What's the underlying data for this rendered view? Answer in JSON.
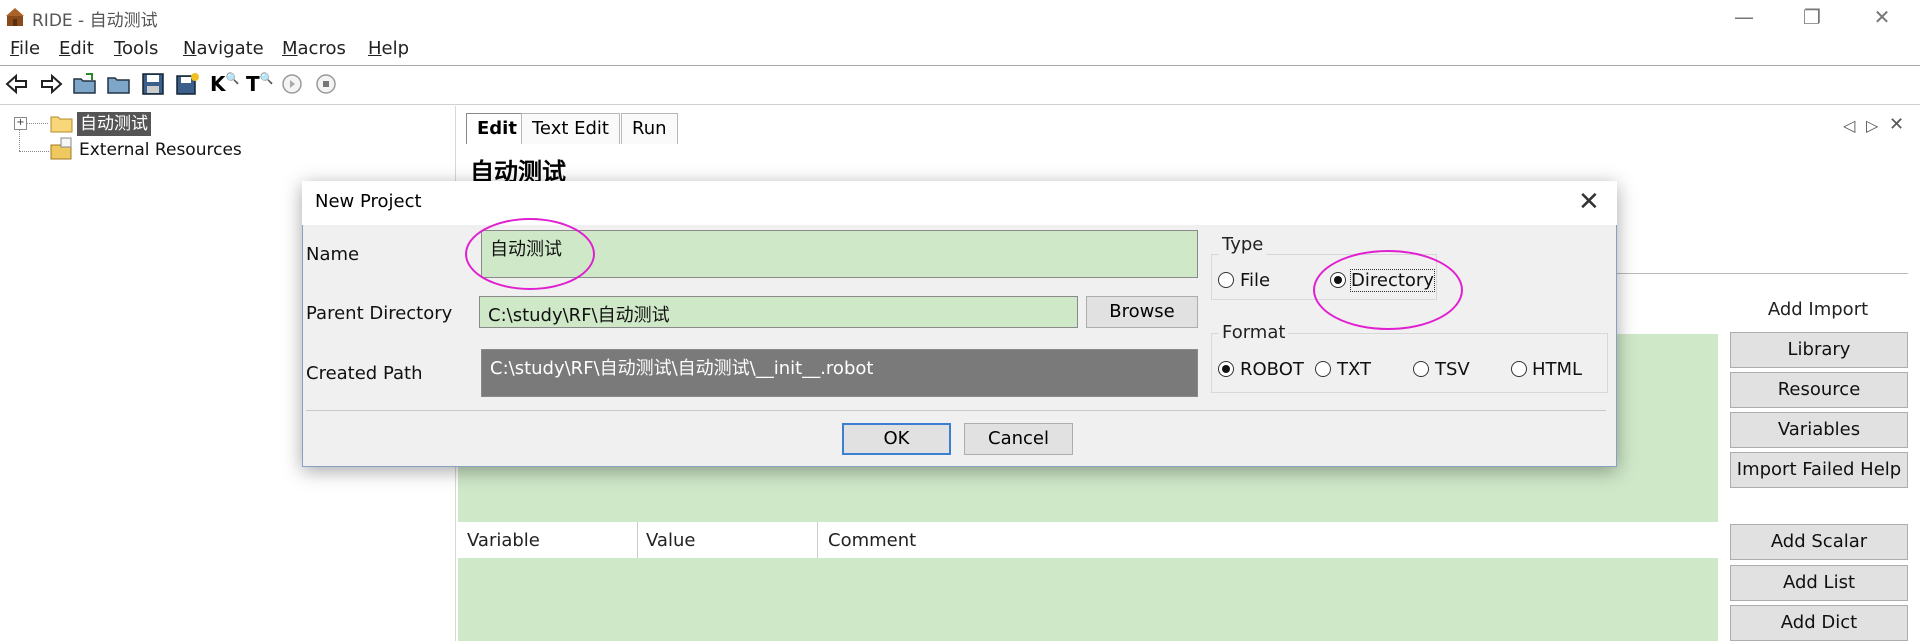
{
  "window": {
    "title": "RIDE - 自动测试",
    "controls": [
      "minimize",
      "restore",
      "close"
    ]
  },
  "menu": [
    {
      "label": "File",
      "key": "F",
      "rest": "ile"
    },
    {
      "label": "Edit",
      "key": "E",
      "rest": "dit"
    },
    {
      "label": "Tools",
      "key": "T",
      "rest": "ools"
    },
    {
      "label": "Navigate",
      "key": "N",
      "rest": "avigate"
    },
    {
      "label": "Macros",
      "key": "M",
      "rest": "acros"
    },
    {
      "label": "Help",
      "key": "H",
      "rest": "elp"
    }
  ],
  "toolbar": {
    "icons": [
      "back-icon",
      "forward-icon",
      "open-project-icon",
      "open-directory-icon",
      "save-icon",
      "save-all-icon",
      "search-keywords-icon",
      "search-tests-icon",
      "run-icon",
      "stop-icon"
    ],
    "k_label": "K",
    "t_label": "T"
  },
  "tree": {
    "root_label": "自动测试",
    "external_label": "External Resources"
  },
  "editor": {
    "tabs": [
      "Edit",
      "Text Edit",
      "Run"
    ],
    "active_tab": "Edit",
    "suite_title": "自动测试",
    "variables_columns": [
      "Variable",
      "Value",
      "Comment"
    ],
    "side": {
      "add_import_label": "Add Import",
      "library": "Library",
      "resource": "Resource",
      "variables": "Variables",
      "import_failed_help": "Import Failed Help",
      "add_scalar": "Add Scalar",
      "add_list": "Add List",
      "add_dict": "Add Dict"
    }
  },
  "dialog": {
    "title": "New Project",
    "name_label": "Name",
    "name_value": "自动测试",
    "parent_label": "Parent Directory",
    "parent_value": "C:\\study\\RF\\自动测试",
    "browse": "Browse",
    "created_label": "Created Path",
    "created_value": "C:\\study\\RF\\自动测试\\自动测试\\__init__.robot",
    "type_label": "Type",
    "type_options": [
      "File",
      "Directory"
    ],
    "type_selected": "Directory",
    "format_label": "Format",
    "format_options": [
      "ROBOT",
      "TXT",
      "TSV",
      "HTML"
    ],
    "format_selected": "ROBOT",
    "ok": "OK",
    "cancel": "Cancel"
  },
  "colors": {
    "grid_green": "#cfe8c8",
    "annotation_magenta": "#e020d0",
    "path_dark": "#7a7a7a"
  }
}
